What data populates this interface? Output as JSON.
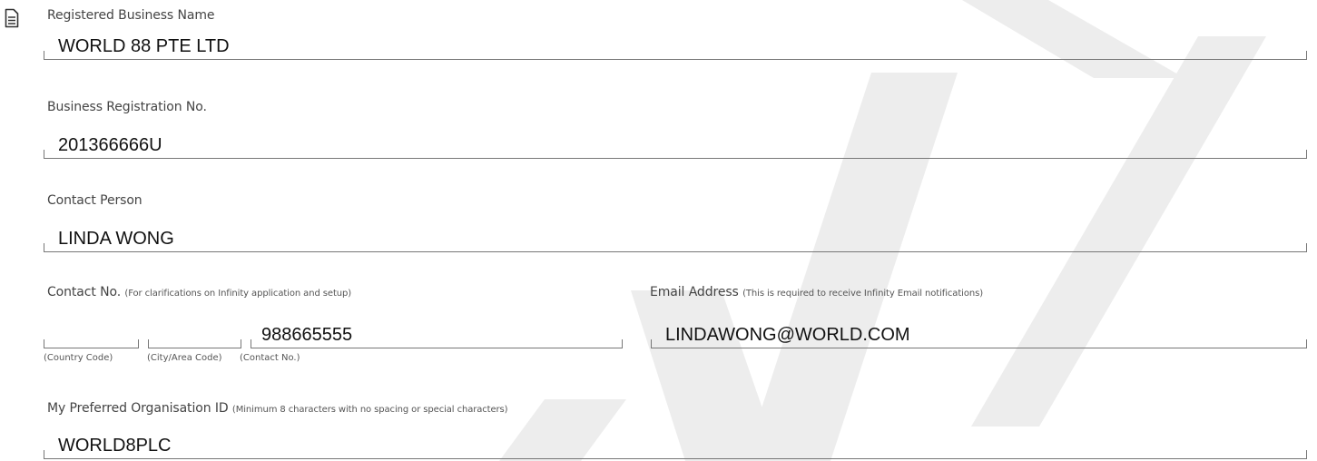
{
  "form": {
    "business_name": {
      "label": "Registered Business Name",
      "value": "WORLD 88 PTE LTD"
    },
    "registration_no": {
      "label": "Business Registration No.",
      "value": "201366666U"
    },
    "contact_person": {
      "label": "Contact Person",
      "value": "LINDA WONG"
    },
    "contact_no": {
      "label": "Contact No.",
      "hint": "(For clarifications on Infinity application and setup)",
      "country_code": "",
      "country_code_label": "(Country Code)",
      "area_code": "",
      "area_code_label": "(City/Area Code)",
      "number": "988665555",
      "number_label": "(Contact No.)"
    },
    "email": {
      "label": "Email Address",
      "hint": "(This is required to receive Infinity Email notifications)",
      "value": "LINDAWONG@WORLD.COM"
    },
    "org_id": {
      "label": "My Preferred Organisation ID",
      "hint": "(Minimum 8 characters with no spacing or special characters)",
      "value": "WORLD8PLC"
    }
  },
  "icons": {
    "document": "document-icon"
  },
  "colors": {
    "watermark": "#ececec",
    "field_line": "#777777",
    "label_text": "#444444",
    "value_text": "#111111"
  }
}
